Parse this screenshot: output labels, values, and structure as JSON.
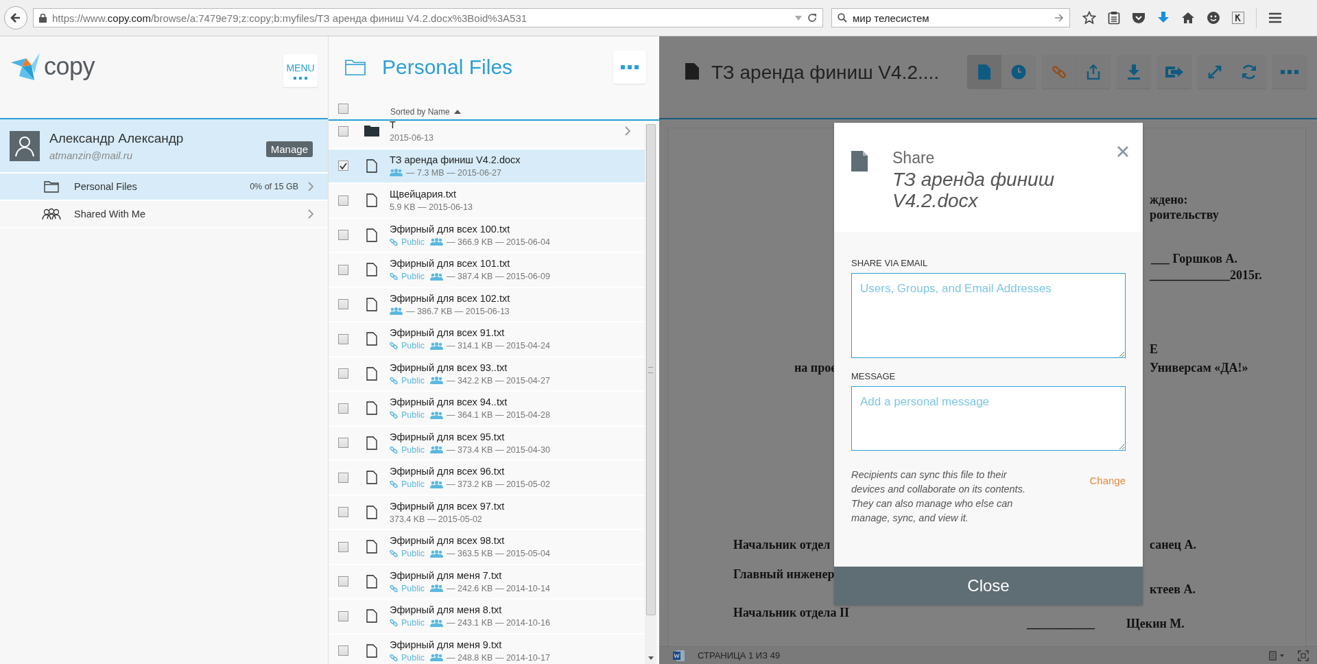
{
  "browser": {
    "url": {
      "scheme": "https://www.",
      "domain": "copy.com",
      "path": "/browse/a:7479e79;z:copy;b:myfiles/ТЗ аренда финиш V4.2.docx%3Boid%3A531"
    },
    "search": {
      "value": "мир телесистем"
    }
  },
  "sidebar": {
    "logo": "copy",
    "menu_button": "MENU",
    "user": {
      "name": "Александр Александр",
      "email": "atmanzin@mail.ru"
    },
    "manage_button": "Manage",
    "items": [
      {
        "kind": "folder",
        "label": "Personal Files",
        "detail": "0% of 15 GB",
        "selected": true
      },
      {
        "kind": "people",
        "label": "Shared With Me",
        "selected": false
      }
    ]
  },
  "files": {
    "title": "Personal Files",
    "sort_label": "Sorted by Name",
    "select_all_checked": false,
    "rows": [
      {
        "kind": "folder",
        "name": "Т",
        "checked": false,
        "selected": false,
        "shared": false,
        "meta": "2015-06-13"
      },
      {
        "kind": "file",
        "name": "ТЗ аренда финиш V4.2.docx",
        "checked": true,
        "selected": true,
        "shared": true,
        "meta": "— 7.3 MB — 2015-06-27"
      },
      {
        "kind": "file",
        "name": "Щвейцария.txt",
        "checked": false,
        "selected": false,
        "shared": false,
        "meta": "5.9 KB — 2015-06-13"
      },
      {
        "kind": "file",
        "name": "Эфирный для всех 100.txt",
        "checked": false,
        "selected": false,
        "public": "Public",
        "shared": true,
        "meta": "— 366.9 KB — 2015-06-04"
      },
      {
        "kind": "file",
        "name": "Эфирный для всех 101.txt",
        "checked": false,
        "selected": false,
        "public": "Public",
        "shared": true,
        "meta": "— 387.4 KB — 2015-06-09"
      },
      {
        "kind": "file",
        "name": "Эфирный для всех 102.txt",
        "checked": false,
        "selected": false,
        "shared": true,
        "meta": "— 386.7 KB — 2015-06-13"
      },
      {
        "kind": "file",
        "name": "Эфирный для всех 91.txt",
        "checked": false,
        "selected": false,
        "public": "Public",
        "shared": true,
        "meta": "— 314.1 KB — 2015-04-24"
      },
      {
        "kind": "file",
        "name": "Эфирный для всех 93..txt",
        "checked": false,
        "selected": false,
        "public": "Public",
        "shared": true,
        "meta": "— 342.2 KB — 2015-04-27"
      },
      {
        "kind": "file",
        "name": "Эфирный для всех 94..txt",
        "checked": false,
        "selected": false,
        "public": "Public",
        "shared": true,
        "meta": "— 364.1 KB — 2015-04-28"
      },
      {
        "kind": "file",
        "name": "Эфирный для всех 95.txt",
        "checked": false,
        "selected": false,
        "public": "Public",
        "shared": true,
        "meta": "— 373.4 KB — 2015-04-30"
      },
      {
        "kind": "file",
        "name": "Эфирный для всех 96.txt",
        "checked": false,
        "selected": false,
        "public": "Public",
        "shared": true,
        "meta": "— 373.2 KB — 2015-05-02"
      },
      {
        "kind": "file",
        "name": "Эфирный для всех 97.txt",
        "checked": false,
        "selected": false,
        "shared": false,
        "meta": "373.4 KB — 2015-05-02"
      },
      {
        "kind": "file",
        "name": "Эфирный для всех 98.txt",
        "checked": false,
        "selected": false,
        "public": "Public",
        "shared": true,
        "meta": "— 363.5 KB — 2015-05-04"
      },
      {
        "kind": "file",
        "name": "Эфирный для меня 7.txt",
        "checked": false,
        "selected": false,
        "public": "Public",
        "shared": true,
        "meta": "— 242.6 KB — 2014-10-14"
      },
      {
        "kind": "file",
        "name": "Эфирный для меня 8.txt",
        "checked": false,
        "selected": false,
        "public": "Public",
        "shared": true,
        "meta": "— 243.1 KB — 2014-10-16"
      },
      {
        "kind": "file",
        "name": "Эфирный для меня 9.txt",
        "checked": false,
        "selected": false,
        "public": "Public",
        "shared": true,
        "meta": "— 248.8 KB — 2014-10-17"
      }
    ]
  },
  "viewer": {
    "title": "ТЗ аренда финиш V4.2....",
    "tools": [
      {
        "kind": "document",
        "selected": true
      },
      {
        "kind": "clock",
        "selected": false
      },
      {
        "kind": "link",
        "selected": false
      },
      {
        "kind": "share",
        "selected": false
      },
      {
        "kind": "download",
        "selected": false
      },
      {
        "kind": "move",
        "selected": false
      },
      {
        "kind": "expand",
        "selected": false
      },
      {
        "kind": "refresh",
        "selected": false
      },
      {
        "kind": "more",
        "selected": false
      }
    ],
    "fragments": [
      "ждено:",
      "роительству",
      "___ Горшков А.",
      "_____________2015г.",
      "Е",
      "на прое",
      "Универсам «ДА!»",
      "Начальник отдел",
      "санец А.",
      "Главный инженер",
      "ктеев А.",
      "Начальник отдела II",
      "___________",
      "Щекин М."
    ],
    "status": "СТРАНИЦА 1 ИЗ 49"
  },
  "dialog": {
    "heading": "Share",
    "file_name": "ТЗ аренда финиш V4.2.docx",
    "email_label": "SHARE VIA EMAIL",
    "email_placeholder": "Users, Groups, and Email Addresses",
    "message_label": "MESSAGE",
    "message_placeholder": "Add a personal message",
    "note": "Recipients can sync this file to their devices and collaborate on its contents. They can also manage who else can manage, sync, and view it.",
    "change_link": "Change",
    "close_button": "Close"
  }
}
